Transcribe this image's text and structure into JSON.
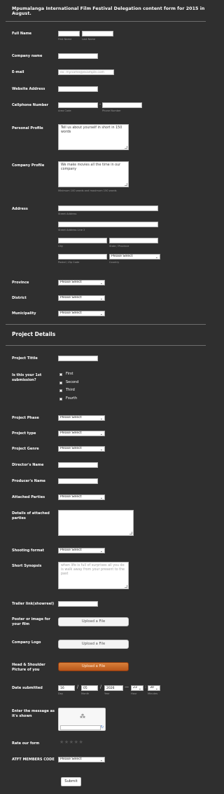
{
  "form": {
    "title": "Mpumalanga International Film Festival Delegation content form for 2015 in August."
  },
  "fields": {
    "full_name": {
      "label": "Full Name",
      "first_sub": "First Name",
      "last_sub": "Last Name"
    },
    "company_name": {
      "label": "Company name"
    },
    "email": {
      "label": "E-mail",
      "placeholder": "ex: myname@example.com"
    },
    "website": {
      "label": "Website Address"
    },
    "cellphone": {
      "label": "Cellphone Number",
      "separator": "-",
      "area_sub": "Area Code",
      "phone_sub": "Phone Number"
    },
    "personal_profile": {
      "label": "Personal Profile",
      "value": "Tell us about yourself in short in 150 words"
    },
    "company_profile": {
      "label": "Company Profile",
      "value": "We make movies all the time in our company",
      "sub": "Minimum 100 words and maximum 150 words"
    },
    "address": {
      "label": "Address",
      "street_sub": "Street Address",
      "street2_sub": "Street Address Line 2",
      "city_sub": "City",
      "state_sub": "State / Province",
      "postal_sub": "Postal / Zip Code",
      "country_sub": "Country",
      "country_value": "Please Select"
    },
    "province": {
      "label": "Province",
      "value": "Please Select"
    },
    "district": {
      "label": "District",
      "value": "Please Select"
    },
    "municipality": {
      "label": "Municipality",
      "value": "Please Select"
    }
  },
  "project": {
    "section_title": "Project Details",
    "project_title": {
      "label": "Project Tittle"
    },
    "first_submission": {
      "label": "Is this your 1st submission?",
      "options": [
        "First",
        "Second",
        "Third",
        "Fourth"
      ]
    },
    "phase": {
      "label": "Project Phase",
      "value": "Please Select"
    },
    "type": {
      "label": "Project type",
      "value": "Please Select"
    },
    "genre": {
      "label": "Project Genre",
      "value": "Please Select"
    },
    "director": {
      "label": "Director's Name"
    },
    "producer": {
      "label": "Producer's Name"
    },
    "attached_parties": {
      "label": "Attached Parties",
      "value": "Please Select"
    },
    "details_parties": {
      "label": "Details of attached parties"
    },
    "shooting_format": {
      "label": "Shooting format",
      "value": "Please Select"
    },
    "synopsis": {
      "label": "Short Synopsis",
      "placeholder": "when life is full of surprises all you do is walk away from your present to the past"
    },
    "trailer": {
      "label": "Trailer link(showreel)"
    },
    "poster": {
      "label": "Poster or image for your film",
      "button": "Upload a File"
    },
    "logo": {
      "label": "Company Logo",
      "button": "Upload a File"
    },
    "headshot": {
      "label": "Head & Shoulder Picture of you",
      "button": "Upload a File"
    },
    "date_submitted": {
      "label": "Date submitted",
      "day": "16",
      "month": "05",
      "year": "2026",
      "day_sub": "Day",
      "month_sub": "Month",
      "year_sub": "Year",
      "hour": "23",
      "minute": "30",
      "hour_sub": "Hour",
      "minute_sub": "Minutes",
      "slash": "/",
      "colon": ":",
      "dash": "—"
    },
    "captcha": {
      "label": "Enter the message as it's shown",
      "loading_icon": "spinner-icon",
      "refresh_icon": "refresh-icon"
    },
    "rating": {
      "label": "Rate our form",
      "stars": "★★★★★",
      "value": 0,
      "max": 5
    },
    "atft_code": {
      "label": "ATFT MEMBERS CODE",
      "value": "Please Select"
    },
    "submit": "Submit"
  },
  "icons": {
    "dropdown": "chevron-down-icon",
    "chevron": "⌄"
  },
  "colors": {
    "background": "#2f2f2f",
    "upload_accent": "#c8682a"
  }
}
